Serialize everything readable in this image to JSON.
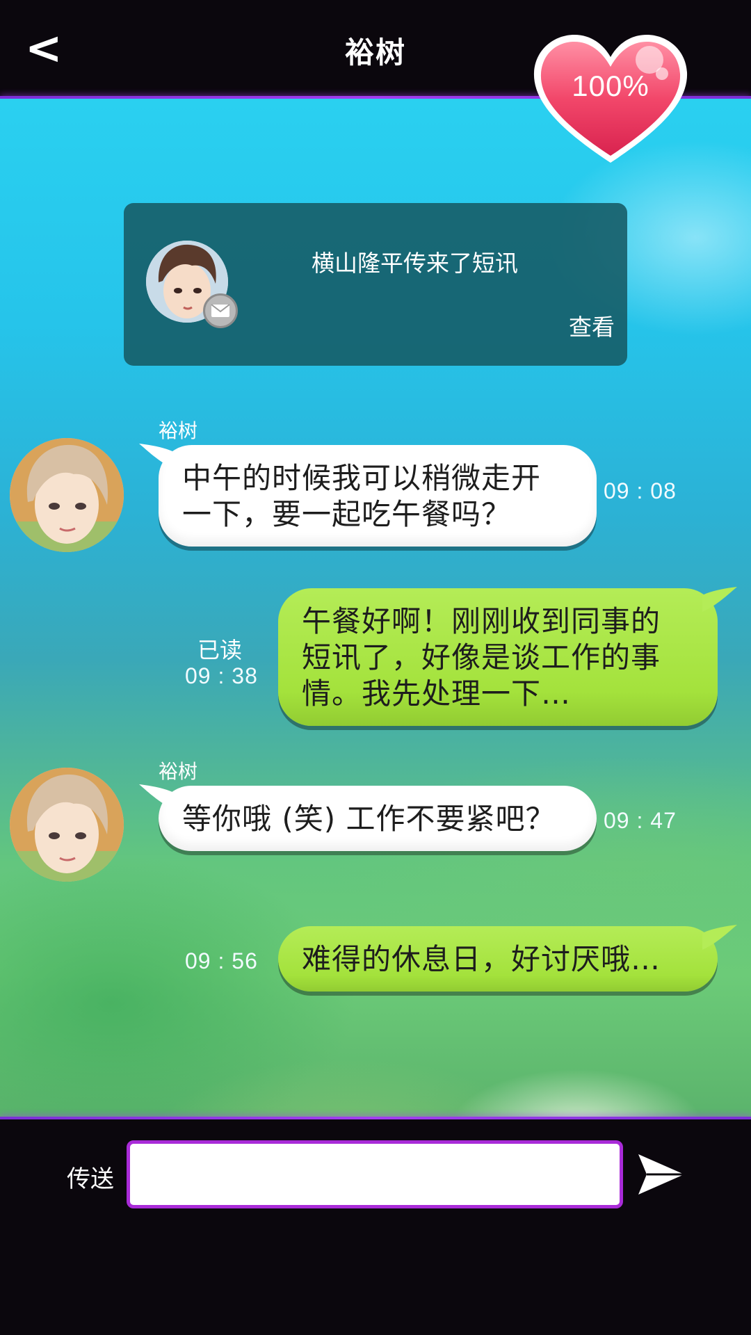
{
  "header": {
    "back_glyph": "<",
    "title": "裕树",
    "affection": "100%"
  },
  "notification": {
    "text": "横山隆平传来了短讯",
    "view_label": "查看",
    "icon": "mail-icon"
  },
  "messages": [
    {
      "side": "left",
      "sender": "裕树",
      "text": "中午的时候我可以稍微走开\n一下，要一起吃午餐吗？",
      "time": "09 : 08"
    },
    {
      "side": "right",
      "status": "已读",
      "text": "午餐好啊！刚刚收到同事的\n短讯了，好像是谈工作的事\n情。我先处理一下…",
      "time": "09 : 38"
    },
    {
      "side": "left",
      "sender": "裕树",
      "text": "等你哦 (笑) 工作不要紧吧？",
      "time": "09 : 47"
    },
    {
      "side": "right",
      "text": "难得的休息日，好讨厌哦…",
      "time": "09 : 56"
    }
  ],
  "composer": {
    "label": "传送",
    "value": "",
    "send_icon": "send-arrow-icon"
  },
  "colors": {
    "accent_purple": "#a33df0",
    "heart_pink": "#f0506e",
    "bubble_green": "#a4e23c",
    "notif_bg": "#165a64"
  }
}
